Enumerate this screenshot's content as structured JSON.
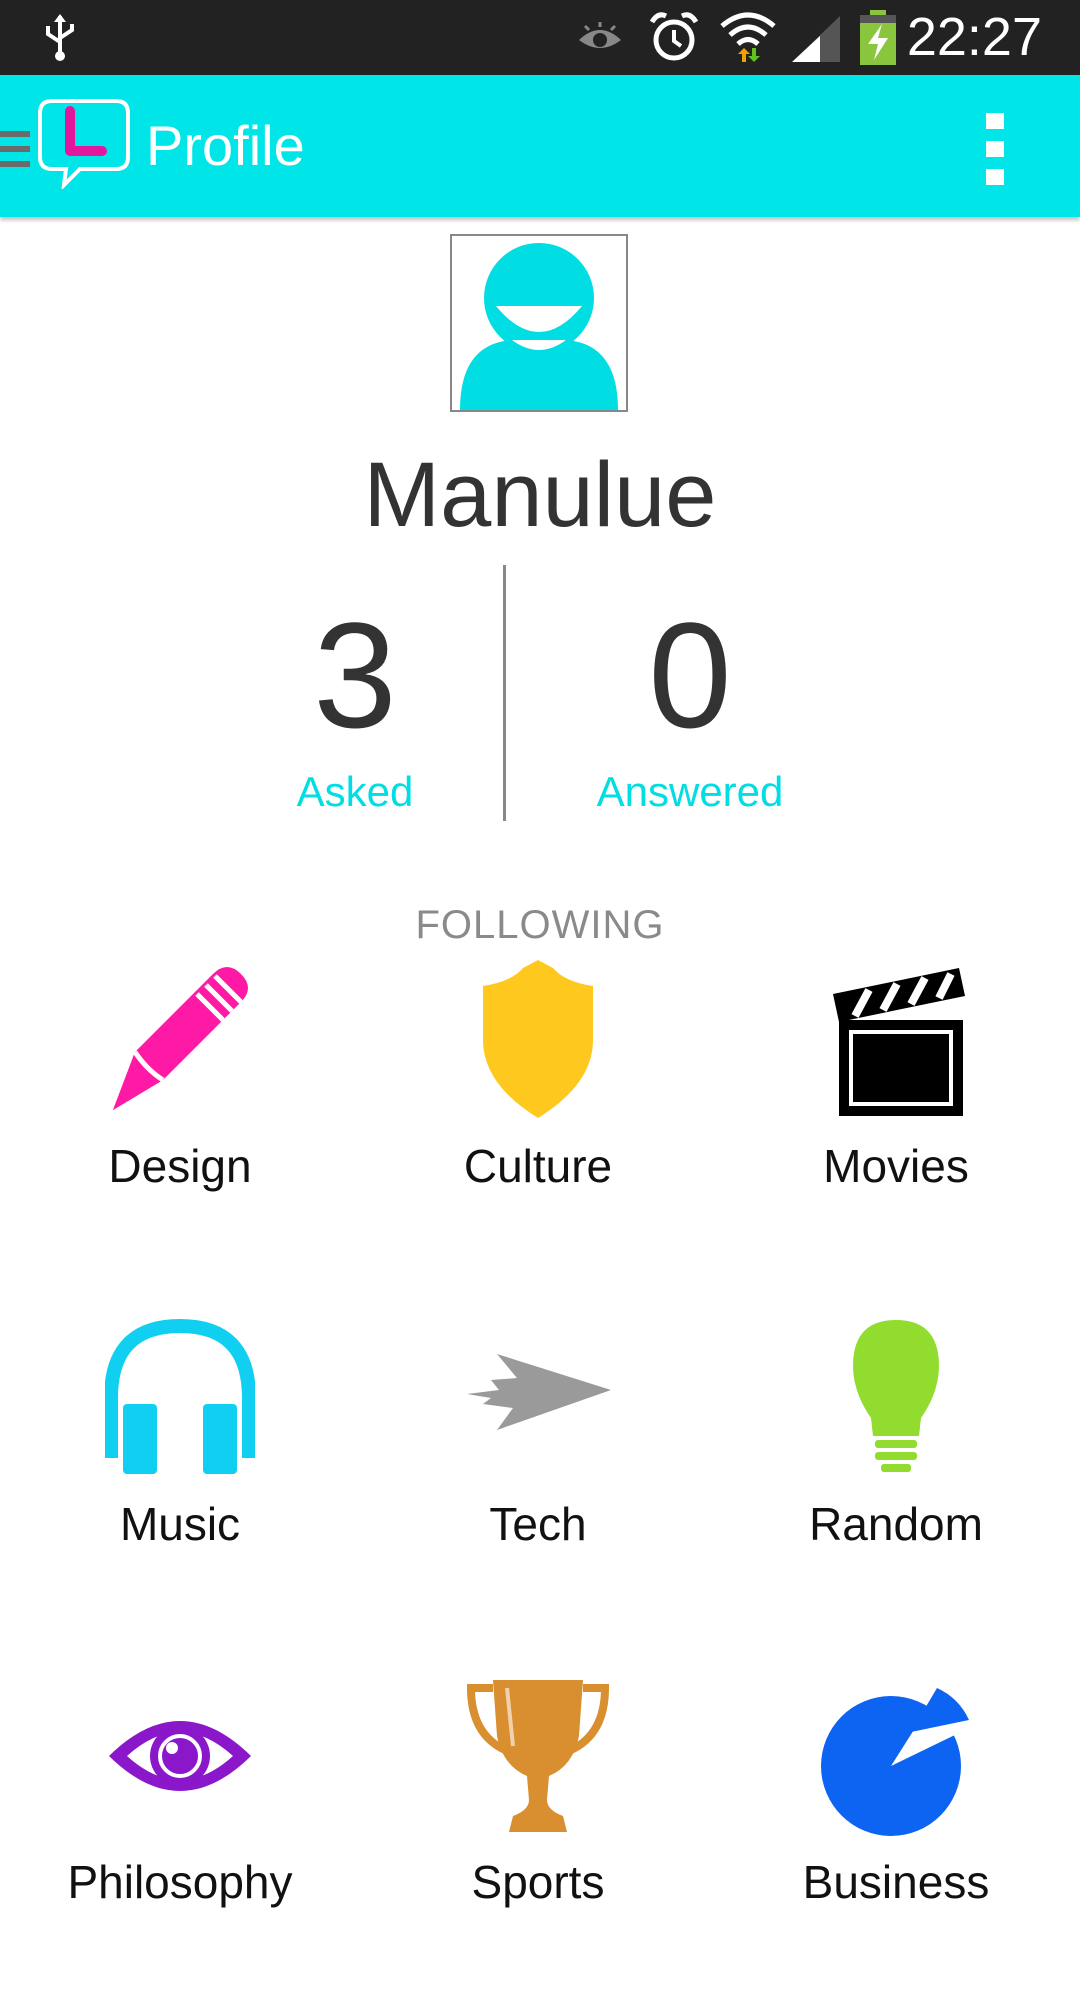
{
  "status_bar": {
    "time": "22:27"
  },
  "app_bar": {
    "title": "Profile"
  },
  "profile": {
    "username": "Manulue",
    "stats": [
      {
        "value": "3",
        "label": "Asked"
      },
      {
        "value": "0",
        "label": "Answered"
      }
    ]
  },
  "following": {
    "heading": "FOLLOWING",
    "categories": [
      {
        "label": "Design",
        "icon": "pencil-icon",
        "color": "#ff1aa6"
      },
      {
        "label": "Culture",
        "icon": "shield-icon",
        "color": "#ffc81e"
      },
      {
        "label": "Movies",
        "icon": "clapperboard-icon",
        "color": "#000000"
      },
      {
        "label": "Music",
        "icon": "headphones-icon",
        "color": "#10cff0"
      },
      {
        "label": "Tech",
        "icon": "jet-icon",
        "color": "#9a9a9a"
      },
      {
        "label": "Random",
        "icon": "lightbulb-icon",
        "color": "#92dc2f"
      },
      {
        "label": "Philosophy",
        "icon": "eye-icon",
        "color": "#8a17c9"
      },
      {
        "label": "Sports",
        "icon": "trophy-icon",
        "color": "#d98f2f"
      },
      {
        "label": "Business",
        "icon": "pie-chart-icon",
        "color": "#0d63f2"
      }
    ]
  },
  "colors": {
    "accent": "#00e5e8",
    "status_bar": "#222222"
  }
}
